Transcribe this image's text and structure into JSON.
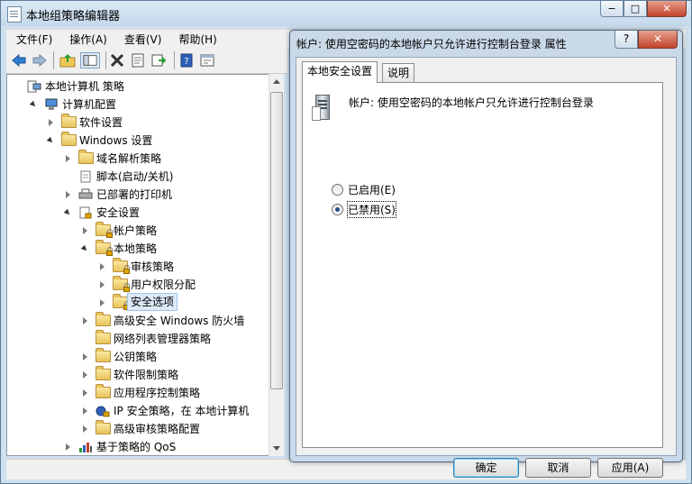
{
  "window": {
    "title": "本地组策略编辑器",
    "min_glyph": "−",
    "max_glyph": "□",
    "close_glyph": "✕"
  },
  "menu": [
    "文件(F)",
    "操作(A)",
    "查看(V)",
    "帮助(H)"
  ],
  "tree": [
    {
      "label": "本地计算机 策略",
      "level": 0,
      "icon": "policy-computer-icon",
      "expand": "none"
    },
    {
      "label": "计算机配置",
      "level": 1,
      "icon": "computer-config-icon",
      "expand": "open"
    },
    {
      "label": "软件设置",
      "level": 2,
      "icon": "folder-icon",
      "expand": "closed"
    },
    {
      "label": "Windows 设置",
      "level": 2,
      "icon": "folder-icon",
      "expand": "open"
    },
    {
      "label": "域名解析策略",
      "level": 3,
      "icon": "folder-icon",
      "expand": "closed"
    },
    {
      "label": "脚本(启动/关机)",
      "level": 3,
      "icon": "script-icon",
      "expand": "none"
    },
    {
      "label": "已部署的打印机",
      "level": 3,
      "icon": "printer-icon",
      "expand": "closed"
    },
    {
      "label": "安全设置",
      "level": 3,
      "icon": "security-settings-icon",
      "expand": "open"
    },
    {
      "label": "帐户策略",
      "level": 4,
      "icon": "folder-lock-icon",
      "expand": "closed"
    },
    {
      "label": "本地策略",
      "level": 4,
      "icon": "folder-lock-icon",
      "expand": "open"
    },
    {
      "label": "审核策略",
      "level": 5,
      "icon": "folder-lock-icon",
      "expand": "closed"
    },
    {
      "label": "用户权限分配",
      "level": 5,
      "icon": "folder-lock-icon",
      "expand": "closed"
    },
    {
      "label": "安全选项",
      "level": 5,
      "icon": "folder-lock-icon",
      "expand": "closed",
      "selected": true
    },
    {
      "label": "高级安全 Windows 防火墙",
      "level": 4,
      "icon": "folder-icon",
      "expand": "closed"
    },
    {
      "label": "网络列表管理器策略",
      "level": 4,
      "icon": "folder-icon",
      "expand": "none"
    },
    {
      "label": "公钥策略",
      "level": 4,
      "icon": "folder-icon",
      "expand": "closed"
    },
    {
      "label": "软件限制策略",
      "level": 4,
      "icon": "folder-icon",
      "expand": "closed"
    },
    {
      "label": "应用程序控制策略",
      "level": 4,
      "icon": "folder-icon",
      "expand": "closed"
    },
    {
      "label": "IP 安全策略，在 本地计算机",
      "level": 4,
      "icon": "ip-security-icon",
      "expand": "closed"
    },
    {
      "label": "高级审核策略配置",
      "level": 4,
      "icon": "folder-icon",
      "expand": "closed"
    },
    {
      "label": "基于策略的 QoS",
      "level": 3,
      "icon": "qos-chart-icon",
      "expand": "closed"
    }
  ],
  "dialog": {
    "title": "帐户: 使用空密码的本地帐户只允许进行控制台登录 属性",
    "help_glyph": "?",
    "close_glyph": "✕",
    "tabs": [
      "本地安全设置",
      "说明"
    ],
    "policy_name": "帐户: 使用空密码的本地帐户只允许进行控制台登录",
    "options": [
      {
        "label": "已启用(E)",
        "checked": false
      },
      {
        "label": "已禁用(S)",
        "checked": true
      }
    ],
    "buttons": {
      "ok": "确定",
      "cancel": "取消",
      "apply": "应用(A)"
    }
  }
}
